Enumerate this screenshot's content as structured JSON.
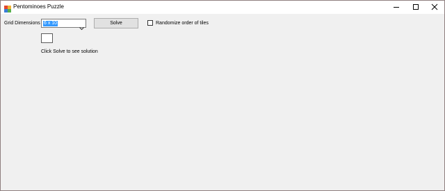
{
  "window": {
    "title": "Pentominoes Puzzle",
    "app_icon": "puzzle-app-icon",
    "caption_icons": [
      "minimize-icon",
      "maximize-icon",
      "close-icon"
    ]
  },
  "controls": {
    "grid_label": "Grid Dimensions",
    "grid_value": "6 x 10",
    "solve_label": "Solve",
    "randomize_label": "Randomize order of tiles",
    "randomize_checked": false
  },
  "status": {
    "message": "Click Solve to see solution"
  },
  "colors": {
    "window_bg": "#f0f0f0",
    "selection": "#3399ff",
    "button_bg": "#e1e1e1"
  }
}
